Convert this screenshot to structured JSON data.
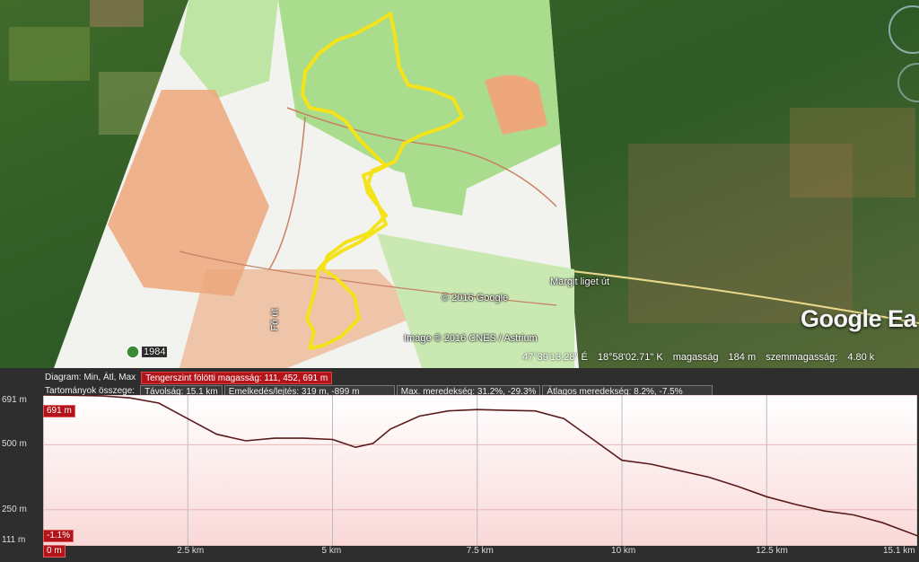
{
  "map": {
    "copyright_google": "© 2016 Google",
    "copyright_image": "Image © 2016 CNES / Astrium",
    "road_label": "Margit liget út",
    "road_label_2": "Fő út",
    "scale_label": "1984",
    "logo": "Google Ea",
    "status": {
      "lat": "47°39'13.28\" É",
      "lon": "18°58'02.71\" K",
      "elev_label": "magasság",
      "elev_value": "184 m",
      "eye_label": "szemmagasság:",
      "eye_value": "4.80 k"
    },
    "colors": {
      "track": "#f4e31a",
      "forest": "#a9dc8c",
      "orange": "#eda77a"
    }
  },
  "elevation": {
    "diagram_label": "Diagram: Min, Átl, Max",
    "altitude_label": "Tengerszint fölötti magasság: 111, 452, 691 m",
    "ranges_label": "Tartományok összege:",
    "distance_label": "Távolság: 15.1 km",
    "gain_label": "Emelkedés/lejtés: 319 m, -899 m",
    "max_slope_label": "Max. meredekség: 31.2%, -29.3%",
    "avg_slope_label": "Átlagos meredekség: 8.2%, -7.5%",
    "tag_max": "691 m",
    "tag_slope": "-1.1%",
    "tag_start": "0 m"
  },
  "chart_data": {
    "type": "area",
    "title": "",
    "xlabel": "",
    "ylabel": "",
    "xlim": [
      0,
      15.1
    ],
    "ylim": [
      111,
      691
    ],
    "x_ticks": [
      "2.5 km",
      "5 km",
      "7.5 km",
      "10 km",
      "12.5 km",
      "15.1 km"
    ],
    "y_ticks": [
      "691 m",
      "500 m",
      "250 m",
      "111 m"
    ],
    "series": [
      {
        "x": [
          0,
          0.5,
          1.0,
          1.5,
          2.0,
          2.5,
          3.0,
          3.5,
          4.0,
          4.5,
          5.0,
          5.4,
          5.7,
          6.0,
          6.5,
          7.0,
          7.5,
          8.0,
          8.5,
          9.0,
          9.5,
          10.0,
          10.5,
          11.0,
          11.5,
          12.0,
          12.5,
          13.0,
          13.5,
          14.0,
          14.5,
          15.1
        ],
        "y": [
          691,
          690,
          688,
          680,
          660,
          600,
          540,
          515,
          525,
          525,
          520,
          490,
          505,
          560,
          610,
          630,
          635,
          632,
          630,
          600,
          520,
          440,
          425,
          400,
          375,
          340,
          300,
          270,
          245,
          230,
          200,
          150
        ]
      }
    ]
  }
}
